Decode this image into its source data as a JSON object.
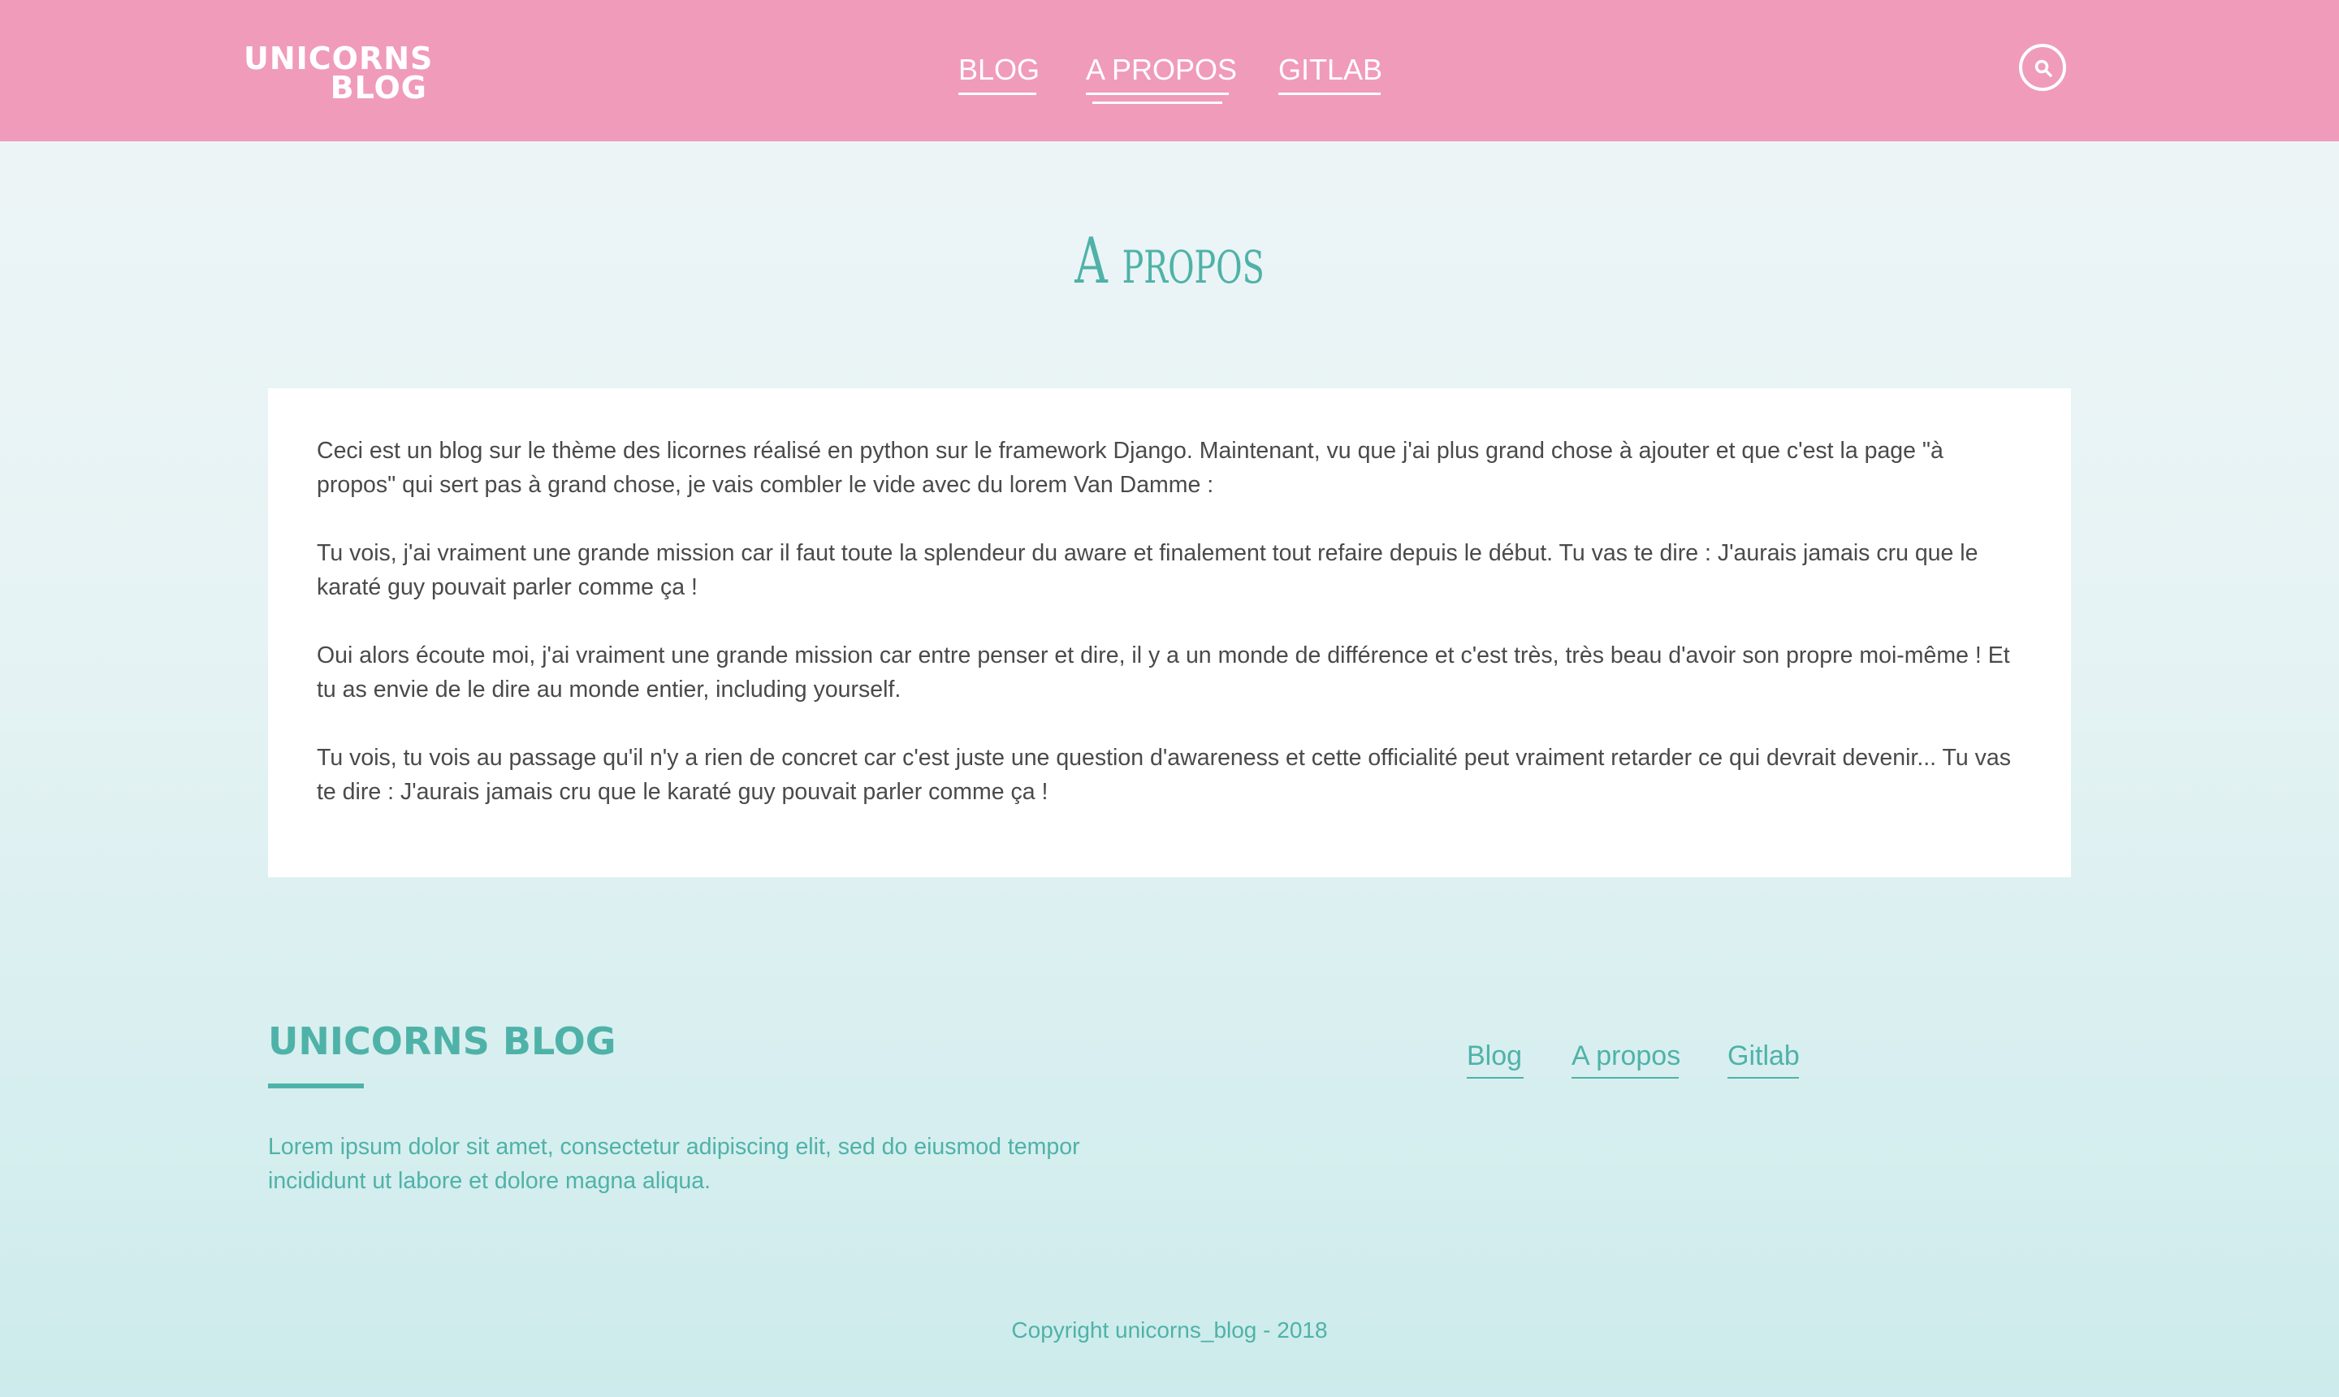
{
  "header": {
    "logo_line1": "UNICORNS",
    "logo_line2": "BLOG",
    "nav": {
      "blog": "BLOG",
      "about": "A PROPOS",
      "gitlab": "GITLAB"
    },
    "search_icon": "search-icon"
  },
  "main": {
    "title": "A propos",
    "paragraphs": [
      "Ceci est un blog sur le thème des licornes réalisé en python sur le framework Django. Maintenant, vu que j'ai plus grand chose à ajouter et que c'est la page \"à propos\" qui sert pas à grand chose, je vais combler le vide avec du lorem Van Damme :",
      "Tu vois, j'ai vraiment une grande mission car il faut toute la splendeur du aware et finalement tout refaire depuis le début. Tu vas te dire : J'aurais jamais cru que le karaté guy pouvait parler comme ça !",
      "Oui alors écoute moi, j'ai vraiment une grande mission car entre penser et dire, il y a un monde de différence et c'est très, très beau d'avoir son propre moi-même ! Et tu as envie de le dire au monde entier, including yourself.",
      "Tu vois, tu vois au passage qu'il n'y a rien de concret car c'est juste une question d'awareness et cette officialité peut vraiment retarder ce qui devrait devenir... Tu vas te dire : J'aurais jamais cru que le karaté guy pouvait parler comme ça !"
    ]
  },
  "footer": {
    "title": "UNICORNS BLOG",
    "text": "Lorem ipsum dolor sit amet, consectetur adipiscing elit, sed do eiusmod tempor incididunt ut labore et dolore magna aliqua.",
    "nav": {
      "blog": "Blog",
      "about": "A propos",
      "gitlab": "Gitlab"
    },
    "copyright": "Copyright unicorns_blog - 2018"
  },
  "colors": {
    "header_bg": "#f09bba",
    "accent_teal": "#4fb2a8",
    "text": "#4a4a4a",
    "card_bg": "#ffffff"
  }
}
